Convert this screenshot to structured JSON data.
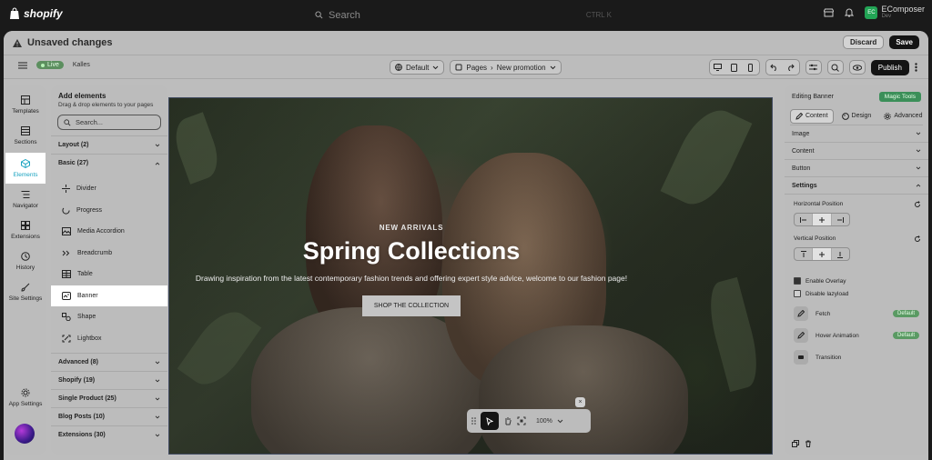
{
  "topbar": {
    "logo_text": "shopify",
    "search_placeholder": "Search",
    "search_shortcut": "CTRL K",
    "app_badge": {
      "abbr": "EC",
      "name": "EComposer",
      "sub": "Dev"
    }
  },
  "unsaved": {
    "text": "Unsaved changes",
    "discard": "Discard",
    "save": "Save"
  },
  "toolbar": {
    "live": "Live",
    "store": "Kalles",
    "template": "Default",
    "pages": "Pages",
    "page": "New promotion",
    "publish": "Publish"
  },
  "rail": {
    "templates": "Templates",
    "sections": "Sections",
    "elements": "Elements",
    "navigator": "Navigator",
    "extensions": "Extensions",
    "history": "History",
    "site_settings": "Site Settings",
    "app_settings": "App Settings"
  },
  "panel": {
    "title": "Add elements",
    "subtitle": "Drag & drop elements to your pages",
    "search_placeholder": "Search...",
    "categories_top": [
      {
        "label": "Layout (2)"
      },
      {
        "label": "Basic (27)"
      }
    ],
    "basic_items": [
      {
        "label": "Divider",
        "icon": "divider-icon"
      },
      {
        "label": "Progress",
        "icon": "progress-icon"
      },
      {
        "label": "Media Accordion",
        "icon": "media-accordion-icon"
      },
      {
        "label": "Breadcrumb",
        "icon": "breadcrumb-icon"
      },
      {
        "label": "Table",
        "icon": "table-icon"
      },
      {
        "label": "Banner",
        "icon": "banner-icon"
      },
      {
        "label": "Shape",
        "icon": "shape-icon"
      },
      {
        "label": "Lightbox",
        "icon": "lightbox-icon"
      }
    ],
    "categories_bottom": [
      {
        "label": "Advanced (8)"
      },
      {
        "label": "Shopify (19)"
      },
      {
        "label": "Single Product (25)"
      },
      {
        "label": "Blog Posts (10)"
      },
      {
        "label": "Extensions (30)"
      }
    ]
  },
  "banner": {
    "eyebrow": "NEW ARRIVALS",
    "title": "Spring Collections",
    "description": "Drawing inspiration from the latest contemporary fashion trends and offering expert style advice, welcome to our fashion page!",
    "cta": "SHOP THE COLLECTION"
  },
  "zoom": {
    "level": "100%",
    "close": "×"
  },
  "right_panel": {
    "title": "Editing Banner",
    "magic": "Magic Tools",
    "tabs": [
      "Content",
      "Design",
      "Advanced"
    ],
    "sections": [
      "Image",
      "Content",
      "Button",
      "Settings"
    ],
    "horizontal_position": "Horizontal Position",
    "vertical_position": "Vertical Position",
    "enable_overlay": "Enable Overlay",
    "disable_lazyload": "Disable lazyload",
    "rows": [
      {
        "label": "Fetch",
        "badge": "Default"
      },
      {
        "label": "Hover Animation",
        "badge": "Default"
      },
      {
        "label": "Transition",
        "badge": ""
      }
    ]
  },
  "colors": {
    "accent": "#1aa3c0",
    "live": "#5c8f5f",
    "magic": "#3b8f59"
  }
}
